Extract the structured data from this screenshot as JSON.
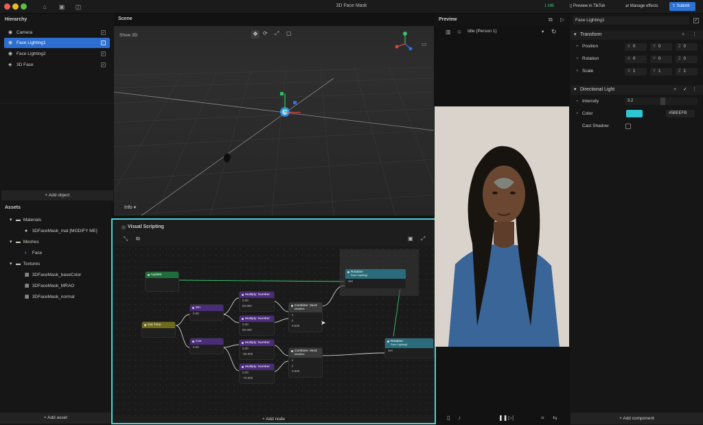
{
  "window": {
    "title": "3D Face Mask",
    "memory": "1 MB"
  },
  "toolbar": {
    "preview_in_tiktok": "Preview in TikTok",
    "manage_effects": "Manage effects",
    "submit": "Submit"
  },
  "hierarchy": {
    "title": "Hierarchy",
    "items": [
      {
        "label": "Camera"
      },
      {
        "label": "Face Lighting1"
      },
      {
        "label": "Face Lighting2"
      },
      {
        "label": "3D Face"
      }
    ],
    "add_object": "+ Add object"
  },
  "assets": {
    "title": "Assets",
    "folders": [
      {
        "label": "Materials",
        "children": [
          "3DFaceMask_mat [MODIFY ME]"
        ]
      },
      {
        "label": "Meshes",
        "children": [
          "Face"
        ]
      },
      {
        "label": "Textures",
        "children": [
          "3DFaceMask_baseColor",
          "3DFaceMask_MRAO",
          "3DFaceMask_normal"
        ]
      }
    ],
    "add_asset": "+ Add asset"
  },
  "scene": {
    "title": "Scene",
    "show_2d": "Show 2D",
    "info": "Info"
  },
  "visual_scripting": {
    "title": "Visual Scripting",
    "add_node": "+ Add node",
    "nodes": {
      "update": {
        "title": "Update"
      },
      "get_time": {
        "title": "Get Time"
      },
      "sin": {
        "title": "Sin",
        "val": "0.00"
      },
      "cos": {
        "title": "Cos",
        "val": "0.00"
      },
      "mul1": {
        "title": "Multiply: Number",
        "a": "0.00",
        "b": "50.000"
      },
      "mul2": {
        "title": "Multiply: Number",
        "a": "0.00",
        "b": "50.000"
      },
      "mul3": {
        "title": "Multiply: Number",
        "a": "0.00",
        "b": "-50.000"
      },
      "mul4": {
        "title": "Multiply: Number",
        "a": "0.00",
        "b": "-70.000"
      },
      "comb1": {
        "title": "Combine: Vec3",
        "sub": "Modified",
        "z": "0.000"
      },
      "comb2": {
        "title": "Combine: Vec3",
        "sub": "Modified",
        "z": "0.000"
      },
      "rot1": {
        "title": "Rotation",
        "sub": "Face Lighting1",
        "set": "Set"
      },
      "rot2": {
        "title": "Rotation",
        "sub": "Face Lighting1",
        "set": "Set"
      }
    }
  },
  "preview": {
    "title": "Preview",
    "state": "Idle (Person 1)"
  },
  "inspector": {
    "object_name": "Face Lighting1",
    "transform": {
      "title": "Transform",
      "position": {
        "label": "Position",
        "x": "0",
        "y": "0",
        "z": "0"
      },
      "rotation": {
        "label": "Rotation",
        "x": "0",
        "y": "0",
        "z": "0"
      },
      "scale": {
        "label": "Scale",
        "x": "1",
        "y": "1",
        "z": "1"
      }
    },
    "light": {
      "title": "Directional Light",
      "intensity_label": "Intensity",
      "intensity": "3.2",
      "color_label": "Color",
      "color_hex": "#5BEEFB",
      "color_swatch": "#2ec6d0",
      "cast_shadow_label": "Cast Shadow"
    },
    "add_component": "+ Add component"
  }
}
